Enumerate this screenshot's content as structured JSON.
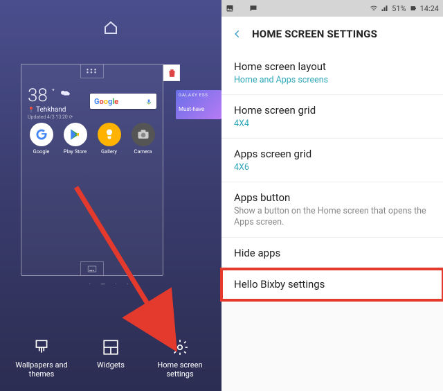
{
  "left": {
    "weather": {
      "temp": "38",
      "deg": "°",
      "location": "Tehkhand",
      "updated": "Updated 4/3 13:20 ⟳"
    },
    "search": {
      "brand": "Google"
    },
    "apps": [
      {
        "name": "Google"
      },
      {
        "name": "Play Store"
      },
      {
        "name": "Gallery"
      },
      {
        "name": "Camera"
      }
    ],
    "peek": {
      "line1": "GALAXY ESS",
      "line2": "Must-have"
    },
    "actions": {
      "wallpapers": "Wallpapers and themes",
      "widgets": "Widgets",
      "settings": "Home screen settings"
    }
  },
  "right": {
    "status": {
      "battery": "51%",
      "time": "14:24"
    },
    "title": "HOME SCREEN SETTINGS",
    "items": {
      "layout": {
        "title": "Home screen layout",
        "sub": "Home and Apps screens"
      },
      "grid": {
        "title": "Home screen grid",
        "sub": "4X4"
      },
      "agrid": {
        "title": "Apps screen grid",
        "sub": "4X6"
      },
      "appsbtn": {
        "title": "Apps button",
        "desc": "Show a button on the Home screen that opens the Apps screen."
      },
      "hide": {
        "title": "Hide apps"
      },
      "bixby": {
        "title": "Hello Bixby settings"
      }
    }
  }
}
